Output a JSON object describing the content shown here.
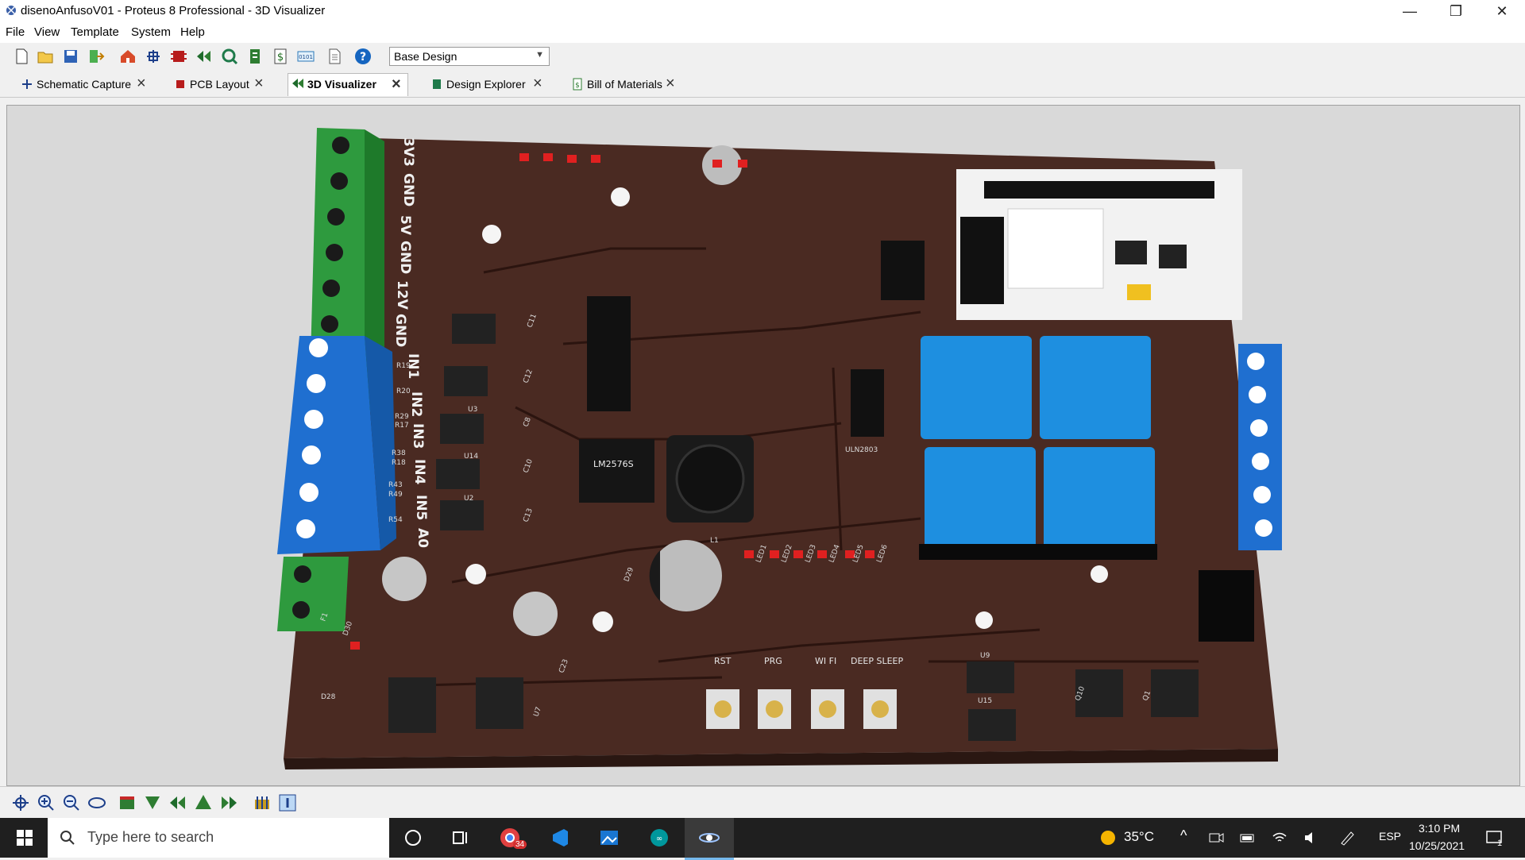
{
  "window": {
    "title": "disenoAnfusoV01 - Proteus 8 Professional - 3D Visualizer",
    "minimize_glyph": "—",
    "maximize_glyph": "❐",
    "close_glyph": "✕"
  },
  "menu": [
    "File",
    "View",
    "Template",
    "System",
    "Help"
  ],
  "toolbar": {
    "icons": [
      "new-icon",
      "open-icon",
      "save-icon",
      "import-icon",
      "home-icon",
      "schematic-icon",
      "pcb-icon",
      "visualizer-icon",
      "explorer-icon",
      "bom-icon",
      "dollar-icon",
      "binary-icon",
      "document-icon",
      "help-icon"
    ],
    "variant_value": "Base Design"
  },
  "tabs": [
    {
      "label": "Schematic Capture",
      "icon": "schematic-icon"
    },
    {
      "label": "PCB Layout",
      "icon": "pcb-icon"
    },
    {
      "label": "3D Visualizer",
      "icon": "visualizer-icon"
    },
    {
      "label": "Design Explorer",
      "icon": "explorer-icon"
    },
    {
      "label": "Bill of Materials",
      "icon": "bom-icon"
    }
  ],
  "active_tab": "3D Visualizer",
  "board": {
    "terminal_labels": [
      "3V3",
      "GND",
      "5V",
      "GND",
      "12V",
      "GND"
    ],
    "input_labels": [
      "IN1",
      "IN2",
      "IN3",
      "IN4",
      "IN5",
      "A0"
    ],
    "ic_regulator": "LM2576S",
    "ic_driver": "ULN2803",
    "buttons": [
      "RST",
      "PRG",
      "WI FI",
      "DEEP SLEEP"
    ],
    "refs": [
      "C11",
      "C12",
      "C8",
      "C10",
      "C13",
      "U14",
      "U2",
      "U3",
      "R19",
      "R20",
      "R29",
      "R17",
      "R38",
      "R18",
      "R43",
      "R49",
      "R54",
      "D29",
      "D28",
      "D30",
      "C23",
      "U7",
      "U9",
      "U15",
      "Q10",
      "Q1",
      "L1",
      "F1",
      "LED1",
      "LED2",
      "LED3",
      "LED4",
      "LED5",
      "LED6"
    ]
  },
  "bottom_toolbar": [
    "pan-icon",
    "zoom-in-icon",
    "zoom-out-icon",
    "orbit-icon",
    "view-top-icon",
    "view-bottom-icon",
    "view-left-icon",
    "view-front-icon",
    "view-right-icon",
    "show-height-icon",
    "show-info-icon"
  ],
  "taskbar": {
    "search_placeholder": "Type here to search",
    "temperature": "35°C",
    "language": "ESP",
    "time": "3:10 PM",
    "date": "10/25/2021",
    "notification_count": "1",
    "badge": "34"
  }
}
